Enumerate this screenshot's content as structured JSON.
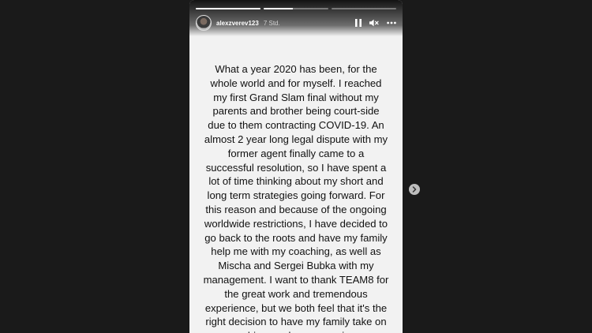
{
  "story": {
    "username": "alexzverev123",
    "timestamp": "7 Std.",
    "progress": [
      1.0,
      0.45,
      0.0
    ],
    "text": "What a year 2020 has been, for the\nwhole world and for myself. I reached\nmy first Grand Slam final without my\nparents and brother being court-side\ndue to them contracting COVID-19. An\nalmost 2 year long legal dispute with my\nformer agent finally came to a\nsuccessful resolution, so I have spent a\nlot of time thinking about my short and\nlong term strategies going forward. For\nthis reason and because of the ongoing\nworldwide restrictions, I have decided to\ngo back to the roots and have my family\nhelp me with my coaching, as well as\nMischa and Sergei Bubka with my\nmanagement. I want to thank TEAM8 for\nthe great work and tremendous\nexperience, but we both feel that it's the\nright decision to have my family take on\na bigger role once again."
  },
  "icons": {
    "pause": "pause-icon",
    "mute": "speaker-muted-icon",
    "more": "more-options-icon",
    "next": "chevron-right-icon"
  },
  "colors": {
    "backdrop": "#1a1a1a",
    "story_bg": "#f2f2f2",
    "text": "#111111"
  }
}
